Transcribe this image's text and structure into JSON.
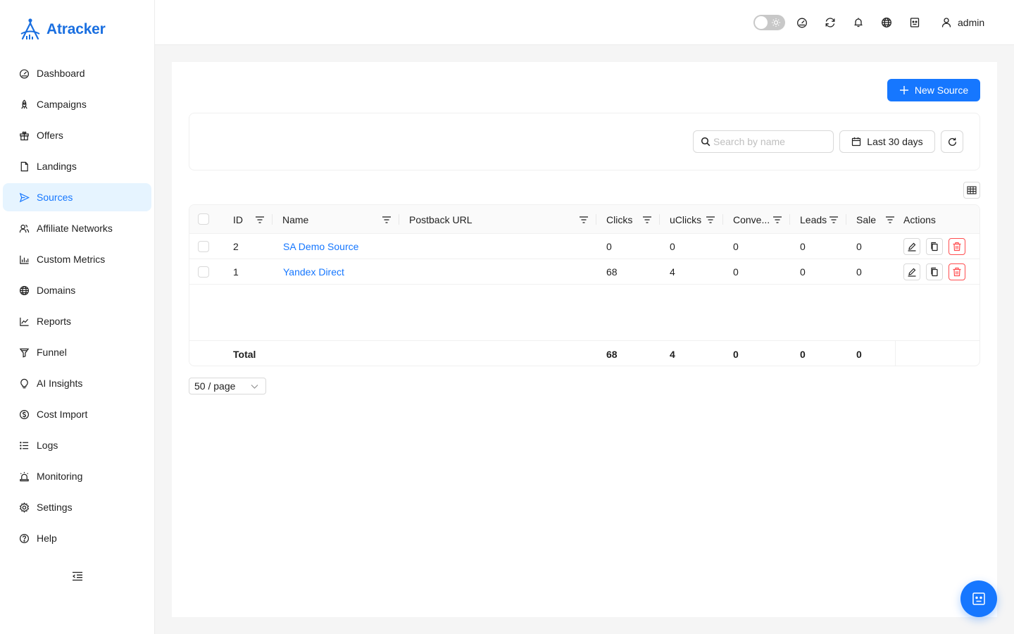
{
  "app": {
    "name": "Atracker",
    "accent": "#1677ff",
    "logo_color": "#1a6fe0"
  },
  "sidebar": {
    "items": [
      {
        "label": "Dashboard",
        "icon": "dashboard-icon"
      },
      {
        "label": "Campaigns",
        "icon": "rocket-icon"
      },
      {
        "label": "Offers",
        "icon": "gift-icon"
      },
      {
        "label": "Landings",
        "icon": "file-icon"
      },
      {
        "label": "Sources",
        "icon": "send-icon",
        "active": true
      },
      {
        "label": "Affiliate Networks",
        "icon": "team-icon"
      },
      {
        "label": "Custom Metrics",
        "icon": "bar-chart-icon"
      },
      {
        "label": "Domains",
        "icon": "globe-icon"
      },
      {
        "label": "Reports",
        "icon": "line-chart-icon"
      },
      {
        "label": "Funnel",
        "icon": "funnel-icon"
      },
      {
        "label": "AI Insights",
        "icon": "bulb-icon"
      },
      {
        "label": "Cost Import",
        "icon": "dollar-icon"
      },
      {
        "label": "Logs",
        "icon": "list-icon"
      },
      {
        "label": "Monitoring",
        "icon": "alert-icon"
      },
      {
        "label": "Settings",
        "icon": "gear-icon"
      },
      {
        "label": "Help",
        "icon": "question-icon"
      }
    ]
  },
  "header": {
    "user": "admin"
  },
  "toolbar": {
    "new_source_label": "New Source"
  },
  "filters": {
    "search_placeholder": "Search by name",
    "date_label": "Last 30 days"
  },
  "table": {
    "columns": [
      "ID",
      "Name",
      "Postback URL",
      "Clicks",
      "uClicks",
      "Conve...",
      "Leads",
      "Sale",
      "Actions"
    ],
    "rows": [
      {
        "id": "2",
        "name": "SA Demo Source",
        "postback": "",
        "clicks": "0",
        "uclicks": "0",
        "conv": "0",
        "leads": "0",
        "sale": "0"
      },
      {
        "id": "1",
        "name": "Yandex Direct",
        "postback": "",
        "clicks": "68",
        "uclicks": "4",
        "conv": "0",
        "leads": "0",
        "sale": "0"
      }
    ],
    "total": {
      "label": "Total",
      "clicks": "68",
      "uclicks": "4",
      "conv": "0",
      "leads": "0",
      "sale": "0"
    }
  },
  "pagination": {
    "page_size": "50 / page"
  },
  "colors": {
    "danger": "#ff4d4f",
    "active_bg": "#e6f4ff"
  }
}
